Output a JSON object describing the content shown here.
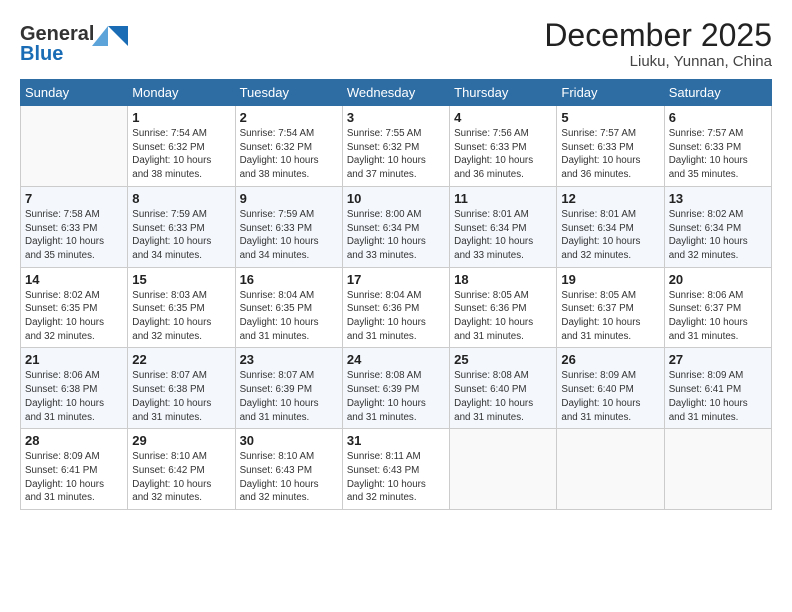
{
  "logo": {
    "line1": "General",
    "line2": "Blue"
  },
  "title": "December 2025",
  "location": "Liuku, Yunnan, China",
  "weekdays": [
    "Sunday",
    "Monday",
    "Tuesday",
    "Wednesday",
    "Thursday",
    "Friday",
    "Saturday"
  ],
  "weeks": [
    [
      {
        "day": "",
        "info": ""
      },
      {
        "day": "1",
        "info": "Sunrise: 7:54 AM\nSunset: 6:32 PM\nDaylight: 10 hours\nand 38 minutes."
      },
      {
        "day": "2",
        "info": "Sunrise: 7:54 AM\nSunset: 6:32 PM\nDaylight: 10 hours\nand 38 minutes."
      },
      {
        "day": "3",
        "info": "Sunrise: 7:55 AM\nSunset: 6:32 PM\nDaylight: 10 hours\nand 37 minutes."
      },
      {
        "day": "4",
        "info": "Sunrise: 7:56 AM\nSunset: 6:33 PM\nDaylight: 10 hours\nand 36 minutes."
      },
      {
        "day": "5",
        "info": "Sunrise: 7:57 AM\nSunset: 6:33 PM\nDaylight: 10 hours\nand 36 minutes."
      },
      {
        "day": "6",
        "info": "Sunrise: 7:57 AM\nSunset: 6:33 PM\nDaylight: 10 hours\nand 35 minutes."
      }
    ],
    [
      {
        "day": "7",
        "info": "Sunrise: 7:58 AM\nSunset: 6:33 PM\nDaylight: 10 hours\nand 35 minutes."
      },
      {
        "day": "8",
        "info": "Sunrise: 7:59 AM\nSunset: 6:33 PM\nDaylight: 10 hours\nand 34 minutes."
      },
      {
        "day": "9",
        "info": "Sunrise: 7:59 AM\nSunset: 6:33 PM\nDaylight: 10 hours\nand 34 minutes."
      },
      {
        "day": "10",
        "info": "Sunrise: 8:00 AM\nSunset: 6:34 PM\nDaylight: 10 hours\nand 33 minutes."
      },
      {
        "day": "11",
        "info": "Sunrise: 8:01 AM\nSunset: 6:34 PM\nDaylight: 10 hours\nand 33 minutes."
      },
      {
        "day": "12",
        "info": "Sunrise: 8:01 AM\nSunset: 6:34 PM\nDaylight: 10 hours\nand 32 minutes."
      },
      {
        "day": "13",
        "info": "Sunrise: 8:02 AM\nSunset: 6:34 PM\nDaylight: 10 hours\nand 32 minutes."
      }
    ],
    [
      {
        "day": "14",
        "info": "Sunrise: 8:02 AM\nSunset: 6:35 PM\nDaylight: 10 hours\nand 32 minutes."
      },
      {
        "day": "15",
        "info": "Sunrise: 8:03 AM\nSunset: 6:35 PM\nDaylight: 10 hours\nand 32 minutes."
      },
      {
        "day": "16",
        "info": "Sunrise: 8:04 AM\nSunset: 6:35 PM\nDaylight: 10 hours\nand 31 minutes."
      },
      {
        "day": "17",
        "info": "Sunrise: 8:04 AM\nSunset: 6:36 PM\nDaylight: 10 hours\nand 31 minutes."
      },
      {
        "day": "18",
        "info": "Sunrise: 8:05 AM\nSunset: 6:36 PM\nDaylight: 10 hours\nand 31 minutes."
      },
      {
        "day": "19",
        "info": "Sunrise: 8:05 AM\nSunset: 6:37 PM\nDaylight: 10 hours\nand 31 minutes."
      },
      {
        "day": "20",
        "info": "Sunrise: 8:06 AM\nSunset: 6:37 PM\nDaylight: 10 hours\nand 31 minutes."
      }
    ],
    [
      {
        "day": "21",
        "info": "Sunrise: 8:06 AM\nSunset: 6:38 PM\nDaylight: 10 hours\nand 31 minutes."
      },
      {
        "day": "22",
        "info": "Sunrise: 8:07 AM\nSunset: 6:38 PM\nDaylight: 10 hours\nand 31 minutes."
      },
      {
        "day": "23",
        "info": "Sunrise: 8:07 AM\nSunset: 6:39 PM\nDaylight: 10 hours\nand 31 minutes."
      },
      {
        "day": "24",
        "info": "Sunrise: 8:08 AM\nSunset: 6:39 PM\nDaylight: 10 hours\nand 31 minutes."
      },
      {
        "day": "25",
        "info": "Sunrise: 8:08 AM\nSunset: 6:40 PM\nDaylight: 10 hours\nand 31 minutes."
      },
      {
        "day": "26",
        "info": "Sunrise: 8:09 AM\nSunset: 6:40 PM\nDaylight: 10 hours\nand 31 minutes."
      },
      {
        "day": "27",
        "info": "Sunrise: 8:09 AM\nSunset: 6:41 PM\nDaylight: 10 hours\nand 31 minutes."
      }
    ],
    [
      {
        "day": "28",
        "info": "Sunrise: 8:09 AM\nSunset: 6:41 PM\nDaylight: 10 hours\nand 31 minutes."
      },
      {
        "day": "29",
        "info": "Sunrise: 8:10 AM\nSunset: 6:42 PM\nDaylight: 10 hours\nand 32 minutes."
      },
      {
        "day": "30",
        "info": "Sunrise: 8:10 AM\nSunset: 6:43 PM\nDaylight: 10 hours\nand 32 minutes."
      },
      {
        "day": "31",
        "info": "Sunrise: 8:11 AM\nSunset: 6:43 PM\nDaylight: 10 hours\nand 32 minutes."
      },
      {
        "day": "",
        "info": ""
      },
      {
        "day": "",
        "info": ""
      },
      {
        "day": "",
        "info": ""
      }
    ]
  ]
}
